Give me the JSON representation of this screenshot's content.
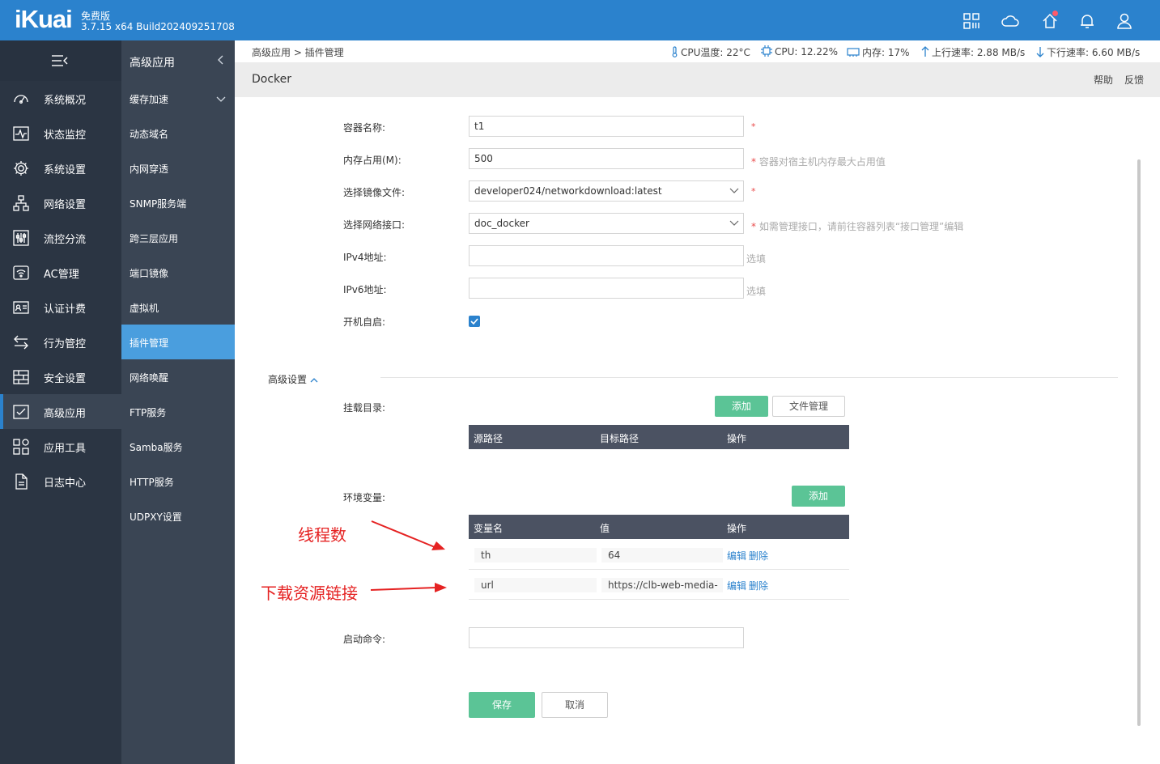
{
  "header": {
    "logo": "iKuai",
    "edition": "免费版",
    "build": "3.7.15 x64 Build202409251708",
    "icons": [
      "apps-grid-icon",
      "cloud-icon",
      "home-upgrade-icon",
      "bell-icon",
      "user-icon"
    ]
  },
  "sidebar": {
    "items": [
      {
        "label": "系统概况",
        "icon": "dashboard-icon"
      },
      {
        "label": "状态监控",
        "icon": "monitor-pulse-icon"
      },
      {
        "label": "系统设置",
        "icon": "gear-icon"
      },
      {
        "label": "网络设置",
        "icon": "network-tree-icon"
      },
      {
        "label": "流控分流",
        "icon": "sliders-icon"
      },
      {
        "label": "AC管理",
        "icon": "wifi-ap-icon"
      },
      {
        "label": "认证计费",
        "icon": "id-card-icon"
      },
      {
        "label": "行为管控",
        "icon": "swap-arrows-icon"
      },
      {
        "label": "安全设置",
        "icon": "firewall-icon"
      },
      {
        "label": "高级应用",
        "icon": "checklist-icon"
      },
      {
        "label": "应用工具",
        "icon": "tools-grid-icon"
      },
      {
        "label": "日志中心",
        "icon": "document-icon"
      }
    ]
  },
  "subnav": {
    "title": "高级应用",
    "items": [
      "缓存加速",
      "动态域名",
      "内网穿透",
      "SNMP服务端",
      "跨三层应用",
      "端口镜像",
      "虚拟机",
      "插件管理",
      "网络唤醒",
      "FTP服务",
      "Samba服务",
      "HTTP服务",
      "UDPXY设置"
    ]
  },
  "breadcrumb": "高级应用 > 插件管理",
  "stats": {
    "cpu_temp": "CPU温度: 22°C",
    "cpu": "CPU: 12.22%",
    "mem": "内存: 17%",
    "up": "上行速率: 2.88 MB/s",
    "down": "下行速率: 6.60 MB/s"
  },
  "page": {
    "title": "Docker",
    "help": "帮助",
    "feedback": "反馈"
  },
  "form": {
    "name_label": "容器名称:",
    "name_value": "t1",
    "mem_label": "内存占用(M):",
    "mem_value": "500",
    "mem_hint": "容器对宿主机内存最大占用值",
    "image_label": "选择镜像文件:",
    "image_value": "developer024/networkdownload:latest",
    "iface_label": "选择网络接口:",
    "iface_value": "doc_docker",
    "iface_hint": "如需管理接口，请前往容器列表“接口管理”编辑",
    "ipv4_label": "IPv4地址:",
    "ipv6_label": "IPv6地址:",
    "optional": "选填",
    "autostart_label": "开机自启:",
    "required_mark": "*"
  },
  "advanced": {
    "label": "高级设置",
    "mount_label": "挂载目录:",
    "add": "添加",
    "file_mgmt": "文件管理",
    "mount_headers": [
      "源路径",
      "目标路径",
      "操作"
    ],
    "env_label": "环境变量:",
    "env_headers": [
      "变量名",
      "值",
      "操作"
    ],
    "env_rows": [
      {
        "name": "th",
        "value": "64"
      },
      {
        "name": "url",
        "value": "https://clb-web-media-"
      }
    ],
    "edit": "编辑",
    "delete": "删除",
    "cmd_label": "启动命令:"
  },
  "actions": {
    "save": "保存",
    "cancel": "取消"
  },
  "annotations": {
    "threads": "线程数",
    "download_link": "下载资源链接"
  },
  "colors": {
    "topbar": "#2b82cd",
    "sidebar": "#2b3543",
    "subnav": "#3a4554",
    "active_sub": "#4a9ede",
    "green": "#5bc496",
    "table_head": "#4b5262",
    "annotation": "#e52222"
  }
}
